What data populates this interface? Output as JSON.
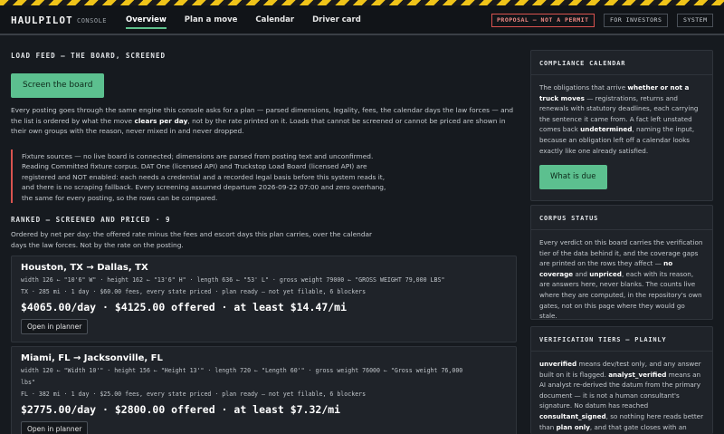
{
  "header": {
    "brand": "HAULPILOT",
    "brand_sub": "CONSOLE",
    "nav": [
      "Overview",
      "Plan a move",
      "Calendar",
      "Driver card"
    ],
    "warning_badge": "PROPOSAL — NOT A PERMIT",
    "for_investors": "FOR INVESTORS",
    "system": "SYSTEM"
  },
  "main": {
    "load_feed_title": "LOAD FEED — THE BOARD, SCREENED",
    "screen_button": "Screen the board",
    "intro_parts": [
      "Every posting goes through the same engine this console asks for a plan — parsed dimensions, legality, fees, the calendar days the law forces — and the list is ordered by what the move ",
      "clears per day",
      ", not by the rate printed on it. Loads that cannot be screened or cannot be priced are shown in their own groups with the reason, never mixed in and never dropped."
    ],
    "notice_lines": [
      "Fixture sources — no live board is connected; dimensions are parsed from posting text and unconfirmed.",
      "Reading Committed fixture corpus. DAT One (licensed API) and Truckstop Load Board (licensed API) are",
      "registered and NOT enabled: each needs a credential and a recorded legal basis before this system reads it,",
      "and there is no scraping fallback. Every screening assumed departure 2026-09-22   07:00 and zero overhang,",
      "the same for every posting, so the rows can be compared."
    ],
    "ranked_title": "RANKED — SCREENED AND PRICED · 9",
    "ranked_desc_lines": [
      "Ordered by net per day: the offered rate minus the fees and escort days this plan carries, over the calendar",
      "days the law forces. Not by the rate on the posting."
    ],
    "cards": [
      {
        "route": "Houston, TX → Dallas, TX",
        "dims": "width 126 ← \"10'6\" W\" · height 162 ← \"13'6\" H\" · length 636 ← \"53' L\" · gross weight 79000 ← \"GROSS WEIGHT 79,000 LBS\"",
        "meta": "TX · 285 mi · 1 day · $60.00 fees, every state priced · plan ready — not yet filable, 6 blockers",
        "price": "$4065.00/day · $4125.00 offered · at least $14.47/mi",
        "button": "Open in planner"
      },
      {
        "route": "Miami, FL → Jacksonville, FL",
        "dims_1": "width 120 ← \"Width 10'\" · height 156 ← \"Height 13'\" · length 720 ← \"Length 60'\" · gross weight 76000 ← \"Gross weight 76,000",
        "dims_2": "lbs\"",
        "meta": "FL · 382 mi · 1 day · $25.00 fees, every state priced · plan ready — not yet filable, 6 blockers",
        "price": "$2775.00/day · $2800.00 offered · at least $7.32/mi",
        "button": "Open in planner"
      }
    ]
  },
  "sidebar": {
    "compliance": {
      "title": "COMPLIANCE CALENDAR",
      "t1": "The obligations that arrive ",
      "b1": "whether or not a truck moves",
      "t2": " — registrations, returns and renewals with statutory deadlines, each carrying the sentence it came from. A fact left unstated comes back ",
      "b2": "undetermined",
      "t3": ", naming the input, because an obligation left off a calendar looks exactly like one already satisfied.",
      "button": "What is due"
    },
    "corpus": {
      "title": "CORPUS STATUS",
      "t1": "Every verdict on this board carries the verification tier of the data behind it, and the coverage gaps are printed on the rows they affect — ",
      "b1": "no coverage",
      "t2": " and ",
      "b2": "unpriced",
      "t3": ", each with its reason, are answers here, never blanks. The counts live where they are computed, in the repository's own gates, not on this page where they would go stale."
    },
    "tiers": {
      "title": "VERIFICATION TIERS — PLAINLY",
      "b1": "unverified",
      "t1": " means dev/test only, and any answer built on it is flagged. ",
      "b2": "analyst_verified",
      "t2": " means an AI analyst re-derived the datum from the primary document — it is not a human consultant's signature. No datum has reached ",
      "b3": "consultant_signed",
      "t3": ", so nothing here reads better than ",
      "b4": "plan only",
      "t4": ", and that gate closes with an"
    }
  }
}
